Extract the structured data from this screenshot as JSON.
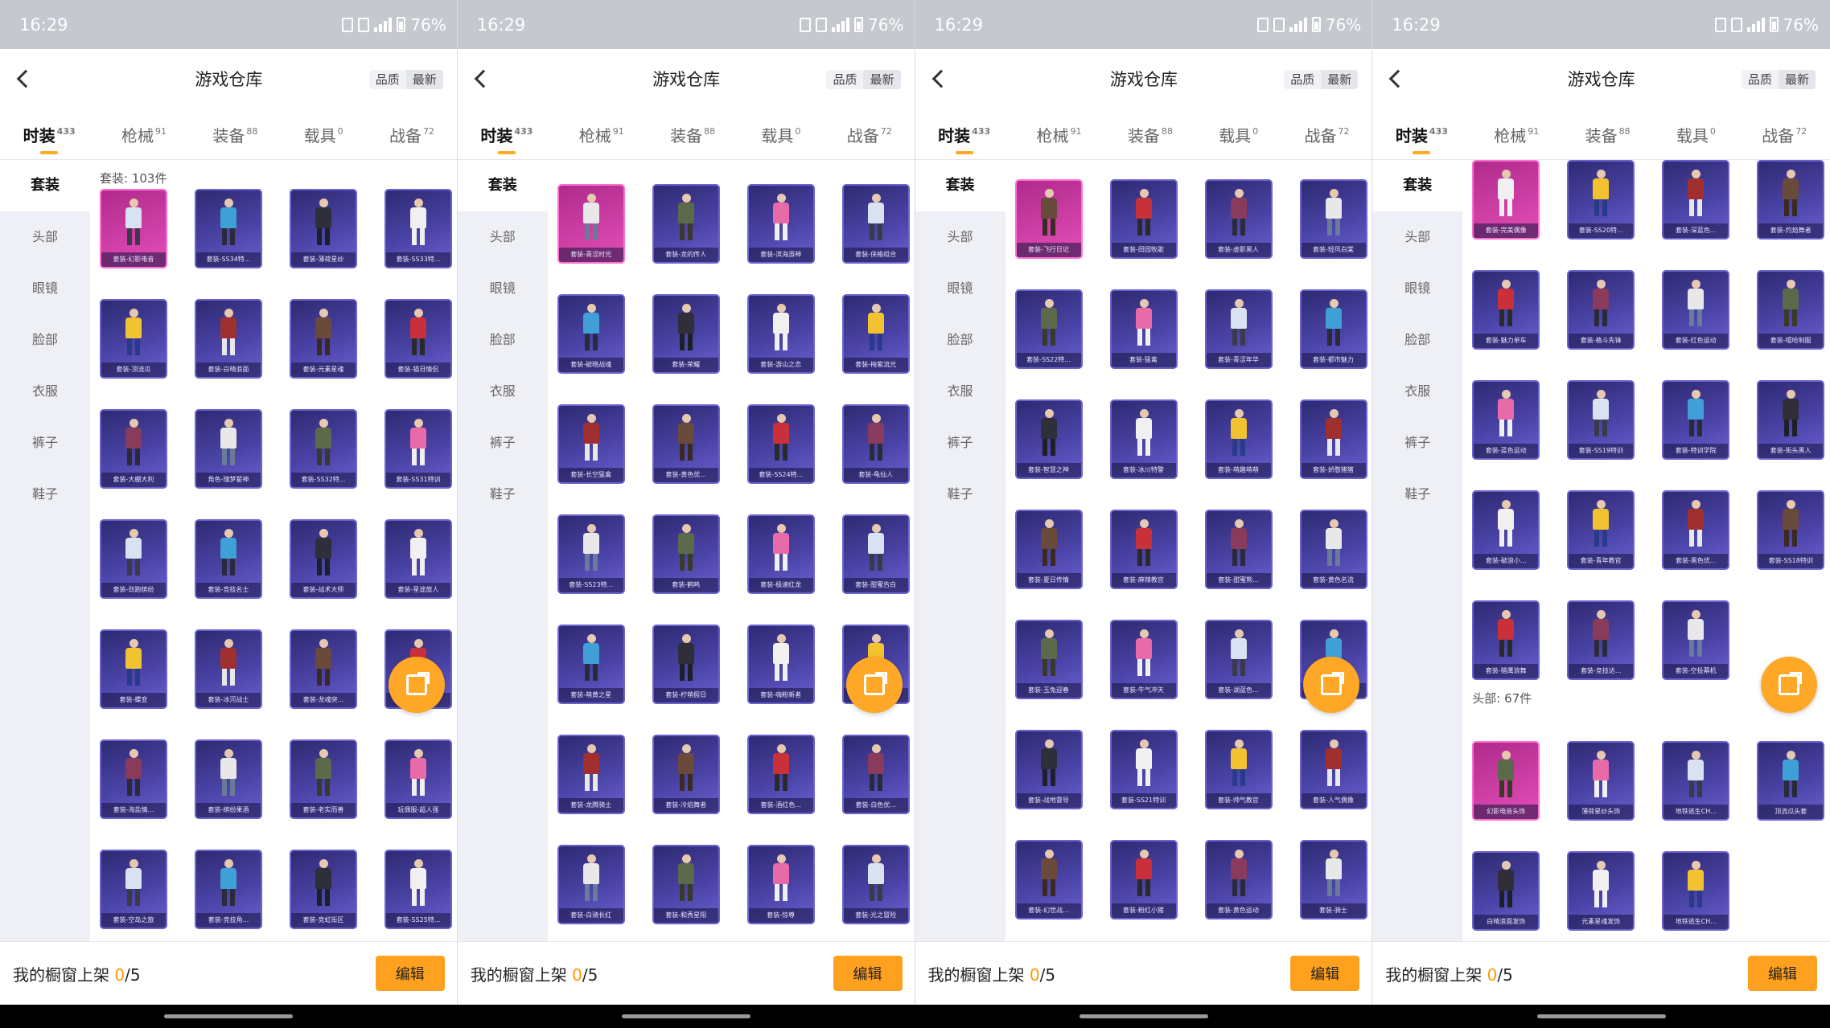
{
  "colors": {
    "accent": "#ffa01e",
    "card": "#4a43a6",
    "card_highlight": "#e44fb8"
  },
  "status": {
    "time": "16:29",
    "battery": "76%"
  },
  "header": {
    "title": "游戏仓库",
    "sort_quality": "品质",
    "sort_latest": "最新"
  },
  "tabs": [
    {
      "label": "时装",
      "count": "433"
    },
    {
      "label": "枪械",
      "count": "91"
    },
    {
      "label": "装备",
      "count": "88"
    },
    {
      "label": "载具",
      "count": "0"
    },
    {
      "label": "战备",
      "count": "72"
    }
  ],
  "sidebar": [
    "套装",
    "头部",
    "眼镜",
    "脸部",
    "衣服",
    "裤子",
    "鞋子"
  ],
  "footer": {
    "label": "我的橱窗上架",
    "shown": "0",
    "total": "/5",
    "edit_label": "编辑"
  },
  "panels": [
    {
      "section_label": "套装: 103件",
      "items": [
        "套装-幻影电音",
        "套装-SS34特...",
        "套装-薄荷星纱",
        "套装-SS33特...",
        "套装-顶流瓜",
        "套装-白晴浪面",
        "套装-元素星魂",
        "套装-猫日情侣",
        "套装-大棚大利",
        "角色-瑰梦翟神",
        "套装-SS32特...",
        "套装-SS31特训",
        "套装-劲跑缤纷",
        "套装-竞技名士",
        "套装-战术大师",
        "套装-星途旅人",
        "套装-蝶变",
        "套装-冰河战士",
        "套装-龙魂突...",
        "套装-海岛探...",
        "套装-海盐情...",
        "套装-缤纷果酒",
        "套装-老实而善",
        "玩偶服-超人强",
        "套装-空岛之旅",
        "套装-竞技角...",
        "套装-竞虹街区",
        "套装-SS25特..."
      ]
    },
    {
      "section_label": "",
      "items": [
        "套装-青涩时光",
        "套装-龙的传人",
        "套装-滨海游神",
        "套装-侠格组合",
        "套装-破晓战魂",
        "套装-荣耀",
        "套装-游山之恋",
        "套装-梅紫流光",
        "套装-长空猛禽",
        "套装-黄色优...",
        "套装-SS24特...",
        "套装-龟仙人",
        "套装-SS23特...",
        "套装-鹤鸣",
        "套装-极速红龙",
        "套装-甜蜜告白",
        "套装-萌黄之星",
        "套装-柠萌假日",
        "套装-嗨粉新者",
        "套装-幻影武者",
        "套装-龙腾骑士",
        "套装-冷焰舞者",
        "套装-酒红色...",
        "套装-白色优...",
        "套装-白骑长红",
        "套装-和秀星阳",
        "套装-惊尊",
        "套装-光之冒险"
      ]
    },
    {
      "section_label": "",
      "items": [
        "套装-飞行日记",
        "套装-田园牧歌",
        "套装-虚影黑人",
        "套装-轻风白棠",
        "套装-SS22特...",
        "套装-猛禽",
        "套装-青涩年华",
        "套装-都市魅力",
        "套装-智慧之神",
        "套装-冰川特警",
        "套装-萌趣萌萌",
        "套装-娇憨猪猪",
        "套装-夏日传情",
        "套装-麻辣教官",
        "套装-甜蜜熊...",
        "套装-黄色名流",
        "套装-玉兔迎春",
        "套装-牛气冲天",
        "套装-湖蓝色...",
        "套装-牛气满满",
        "套装-战地督导",
        "套装-SS21特训",
        "套装-帅气教官",
        "套装-人气偶像",
        "套装-幻世战...",
        "套装-粉红小猪",
        "套装-黄色运动",
        "套装-骑士"
      ]
    },
    {
      "section_label": "头部: 67件",
      "items": [
        "套装-完美偶像",
        "套装-SS20特...",
        "套装-深蓝色...",
        "套装-灼焰舞者",
        "套装-魅力单车",
        "套装-格斗先锋",
        "套装-红色运动",
        "套装-嘻哈制服",
        "套装-蓝色运动",
        "套装-SS19特训",
        "套装-特训学院",
        "套装-街头黑人",
        "套装-破浪小...",
        "套装-青年教官",
        "套装-黑色优...",
        "套装-SS18特训",
        "套装-猎鹰浪舞",
        "套装-竞技达...",
        "套装-空投幕机",
        "幻影电音头饰",
        "薄荷星纱头饰",
        "地铁逃生CH...",
        "顶流瓜头套",
        "白晴浪面发饰",
        "元素星魂发饰",
        "地铁逃生CH...",
        ""
      ]
    }
  ]
}
